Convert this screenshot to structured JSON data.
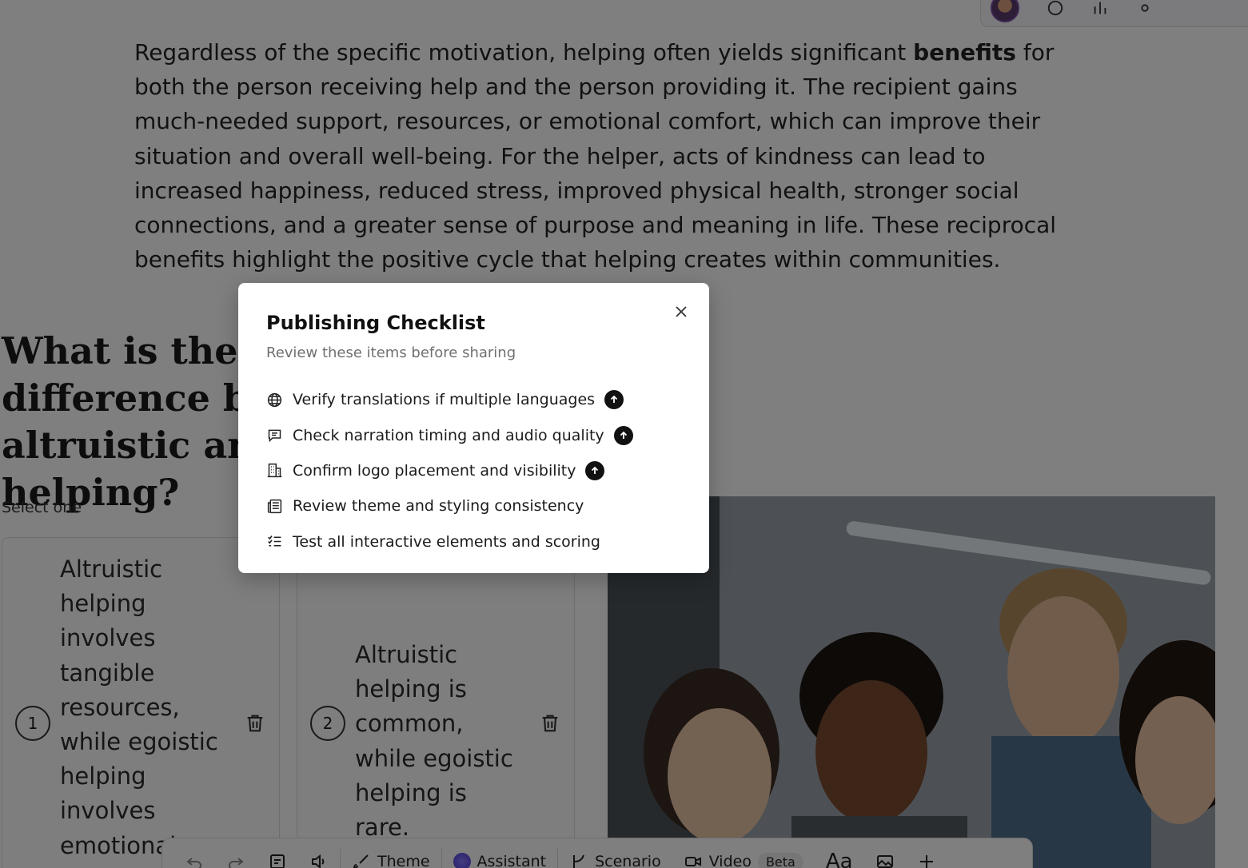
{
  "paragraph": {
    "before": "Regardless of the specific motivation, helping often yields significant ",
    "bold": "benefits",
    "after": " for both the person receiving help and the person providing it. The recipient gains much-needed support, resources, or emotional comfort, which can improve their situation and overall well-being. For the helper, acts of kindness can lead to increased happiness, reduced stress, improved physical health, stronger social connections, and a greater sense of purpose and meaning in life. These reciprocal benefits highlight the positive cycle that helping creates within communities."
  },
  "question": {
    "title": "What is the primary difference between altruistic and egoistic helping?",
    "instruction": "Select one",
    "options": [
      {
        "number": "1",
        "text": "Altruistic helping involves tangible resources, while egoistic helping involves emotional support."
      },
      {
        "number": "2",
        "text": "Altruistic helping is common, while egoistic helping is rare."
      }
    ]
  },
  "bottom_toolbar": {
    "theme": "Theme",
    "assistant": "Assistant",
    "scenario": "Scenario",
    "video": "Video",
    "beta": "Beta",
    "font": "Aa"
  },
  "modal": {
    "title": "Publishing Checklist",
    "subtitle": "Review these items before sharing",
    "items": [
      {
        "icon": "globe-icon",
        "text": "Verify translations if multiple languages",
        "upgrade": true
      },
      {
        "icon": "speech-bubble-icon",
        "text": "Check narration timing and audio quality",
        "upgrade": true
      },
      {
        "icon": "building-icon",
        "text": "Confirm logo placement and visibility",
        "upgrade": true
      },
      {
        "icon": "newspaper-icon",
        "text": "Review theme and styling consistency",
        "upgrade": false
      },
      {
        "icon": "checklist-icon",
        "text": "Test all interactive elements and scoring",
        "upgrade": false
      }
    ]
  },
  "colors": {
    "overlay": "rgba(0,0,0,0.50)",
    "modal_bg": "#ffffff",
    "upgrade_badge": "#111111",
    "subtitle": "#707070"
  }
}
